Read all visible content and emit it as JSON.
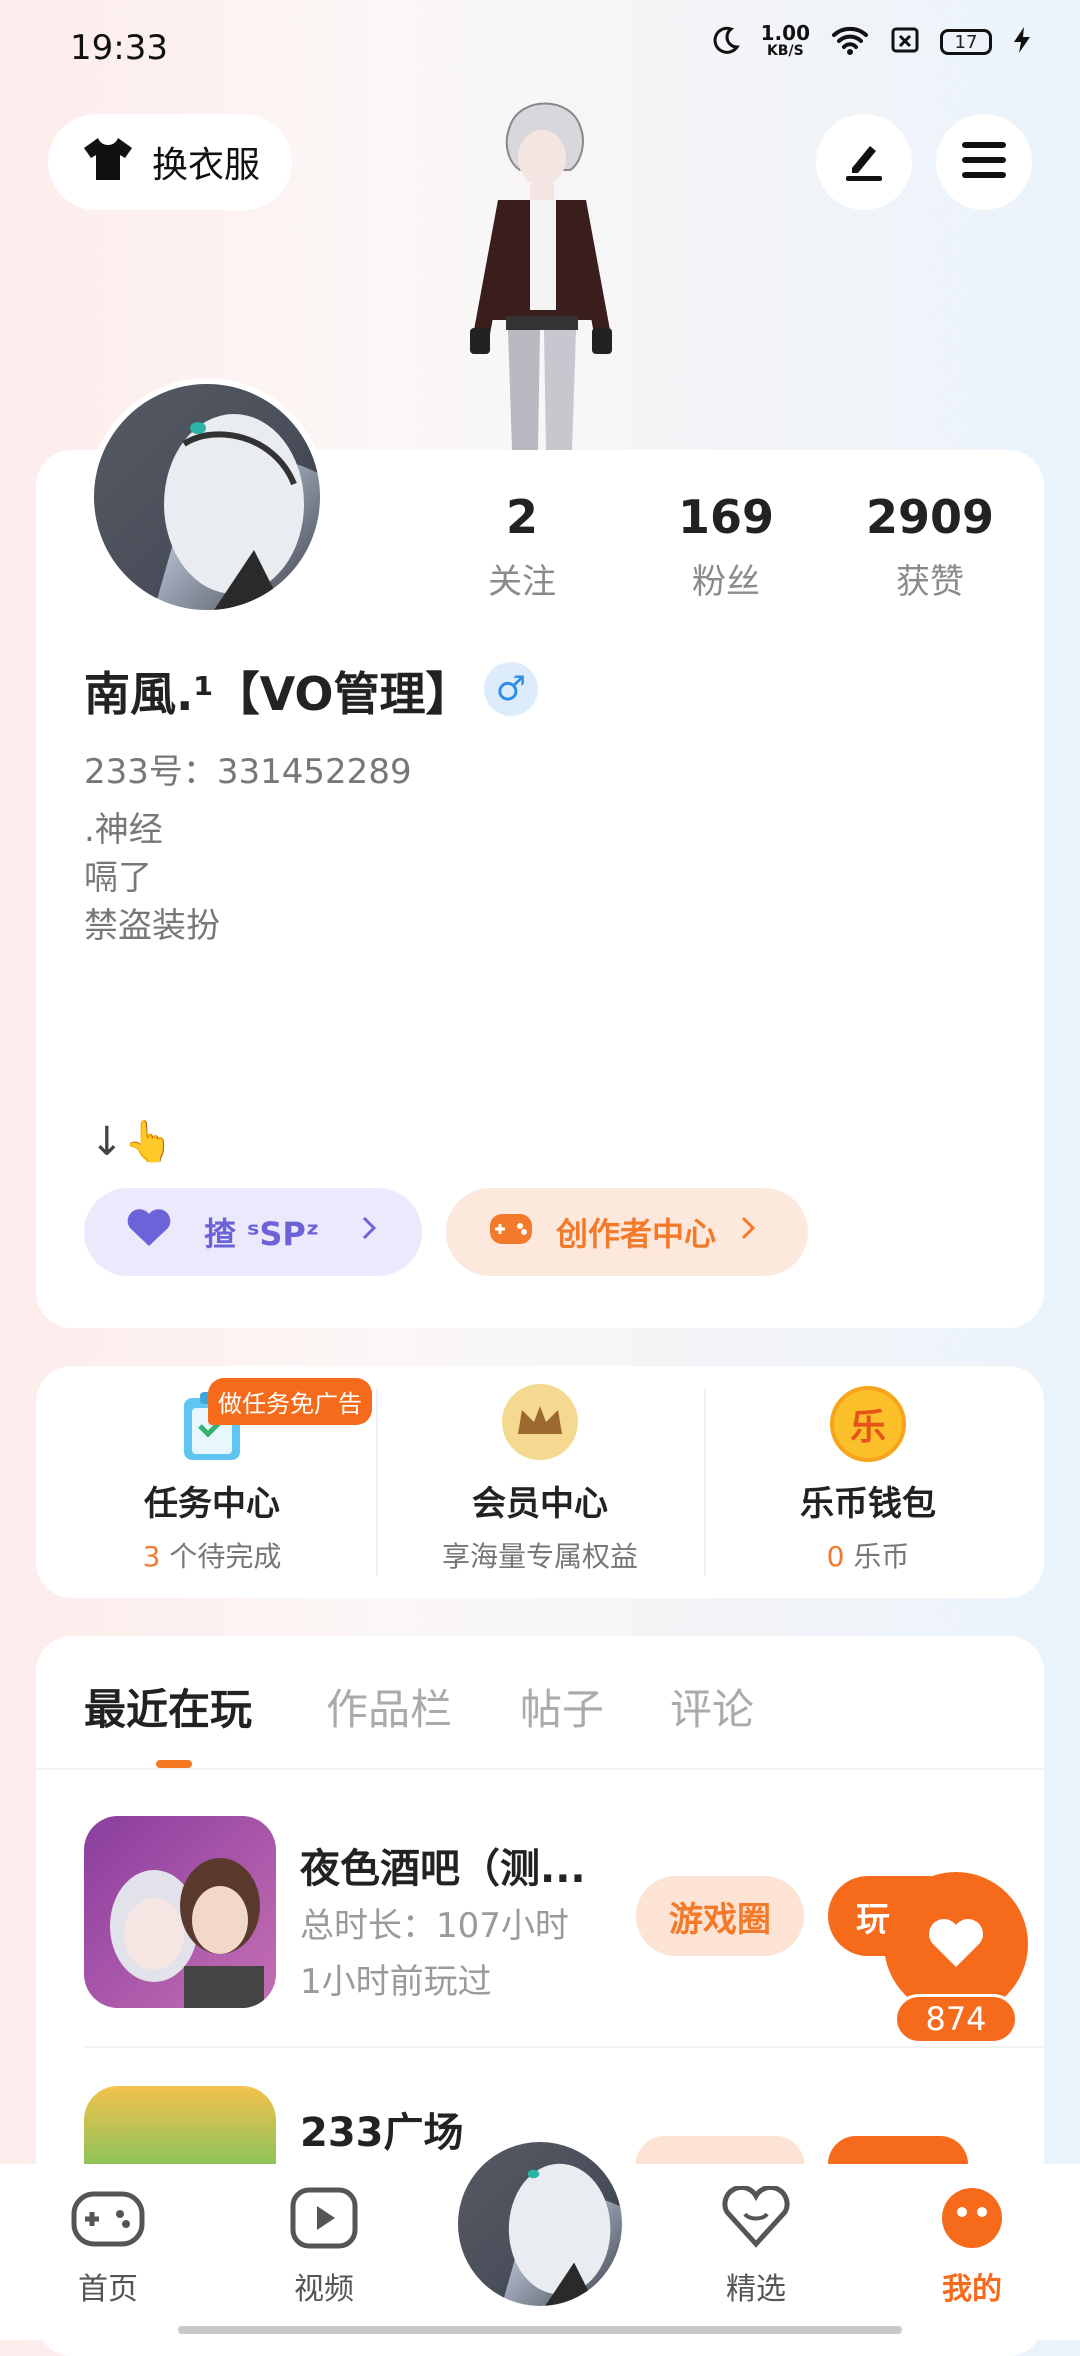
{
  "status": {
    "time": "19:33",
    "net_speed_value": "1.00",
    "net_speed_unit": "KB/S",
    "battery": "17"
  },
  "top": {
    "outfit_label": "换衣服"
  },
  "profile": {
    "stats": [
      {
        "value": "2",
        "label": "关注"
      },
      {
        "value": "169",
        "label": "粉丝"
      },
      {
        "value": "2909",
        "label": "获赞"
      }
    ],
    "name": "南風.¹【VO管理】",
    "gender_symbol": "♂",
    "uid": "233号：331452289",
    "bio_lines": [
      ".神经",
      "嗝了",
      "禁盗装扮"
    ],
    "footer_line": "↓👆",
    "tag_left": "揸 ˢSPᶻ",
    "tag_right": "创作者中心"
  },
  "services": [
    {
      "title": "任务中心",
      "count": "3",
      "sub": "个待完成",
      "badge": "做任务免广告"
    },
    {
      "title": "会员中心",
      "sub": "享海量专属权益"
    },
    {
      "title": "乐币钱包",
      "count": "0",
      "sub": "乐币",
      "icon_char": "乐"
    }
  ],
  "tabs": [
    "最近在玩",
    "作品栏",
    "帖子",
    "评论"
  ],
  "games": [
    {
      "title": "夜色酒吧（测...",
      "duration": "总时长：107小时",
      "last_played": "1小时前玩过",
      "circle_label": "游戏圈",
      "play_label": "玩"
    },
    {
      "title": "233广场"
    }
  ],
  "like": {
    "count": "874"
  },
  "nav": [
    {
      "label": "首页"
    },
    {
      "label": "视频"
    },
    {
      "label": "精选"
    },
    {
      "label": "我的"
    }
  ],
  "colors": {
    "accent": "#f66a1b",
    "purple": "#6c63d8",
    "gender_blue": "#2f8fe6"
  }
}
